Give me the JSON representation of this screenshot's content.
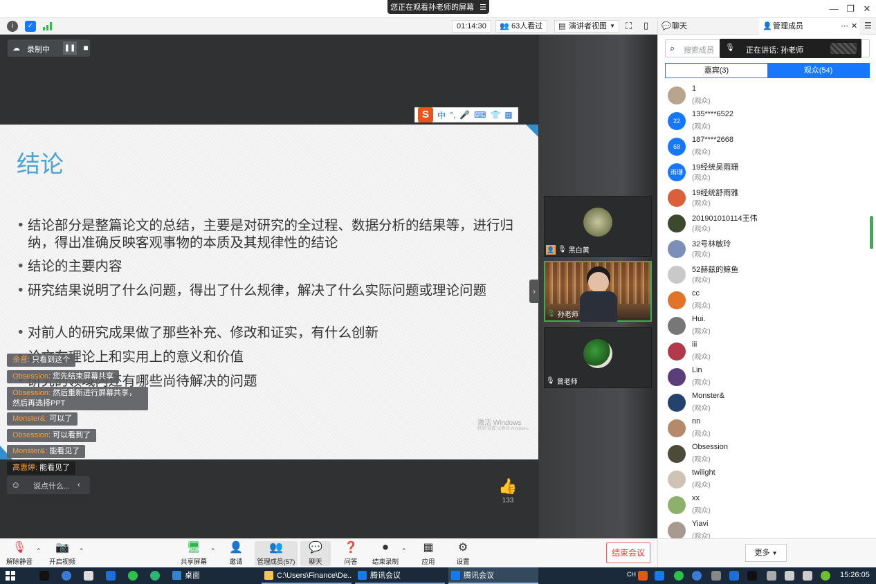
{
  "titlebar": {
    "share_notice": "您正在观看孙老师的屏幕",
    "menu_icon": "menu-icon"
  },
  "infobar": {
    "timer": "01:14:30",
    "viewers": "63人看过",
    "view_mode": "演讲者视图"
  },
  "recording": {
    "label": "录制中"
  },
  "ime": {
    "mode": "中"
  },
  "slide": {
    "title": "结论",
    "bullets": [
      "结论部分是整篇论文的总结，主要是对研究的全过程、数据分析的结果等，进行归纳，得出准确反映客观事物的本质及其规律性的结论",
      "结论的主要内容",
      "研究结果说明了什么问题，得出了什么规律，解决了什么实际问题或理论问题",
      "对前人的研究成果做了那些补充、修改和证实，有什么创新",
      "论文在理论上和实用上的意义和价值",
      "研究的领域内还有哪些尚待解决的问题"
    ],
    "watermark": "激活 Windows",
    "watermark_sub": "转到\"设置\"以激活 Windows。"
  },
  "chat": [
    {
      "name": "余音:",
      "text": "只看到这个"
    },
    {
      "name": "Obsession:",
      "text": "您先结束屏幕共享"
    },
    {
      "name": "Obsession:",
      "text": "然后重新进行屏幕共享，然后再选择PPT"
    },
    {
      "name": "Monster&:",
      "text": "可以了"
    },
    {
      "name": "Obsession:",
      "text": "可以看到了"
    },
    {
      "name": "Monster&:",
      "text": "能看见了"
    },
    {
      "name": "高惠婷:",
      "text": "能看见了"
    }
  ],
  "chat_input": {
    "placeholder": "说点什么..."
  },
  "likes": {
    "count": "133"
  },
  "tiles": [
    {
      "name": "黑白黄"
    },
    {
      "name": "孙老师"
    },
    {
      "name": "曾老师"
    }
  ],
  "rpanel": {
    "tab_chat": "聊天",
    "tab_members": "管理成员",
    "search_placeholder": "搜索成员",
    "speaking": "正在讲话: 孙老师",
    "seg_guests": "嘉宾(3)",
    "seg_audience": "观众(54)",
    "members": [
      {
        "name": "1",
        "role": "(观众)",
        "color": "#b9a58e",
        "avatar": ""
      },
      {
        "name": "135****6522",
        "role": "(观众)",
        "color": "#1677ff",
        "avatar": "22"
      },
      {
        "name": "187****2668",
        "role": "(观众)",
        "color": "#1677ff",
        "avatar": "68"
      },
      {
        "name": "19经统吴雨珊",
        "role": "(观众)",
        "color": "#1677ff",
        "avatar": "雨珊"
      },
      {
        "name": "19经统舒雨雅",
        "role": "(观众)",
        "color": "#d9603b",
        "avatar": ""
      },
      {
        "name": "201901010114王伟",
        "role": "(观众)",
        "color": "#3b4a2c",
        "avatar": ""
      },
      {
        "name": "32号林敏玲",
        "role": "(观众)",
        "color": "#7d8fb8",
        "avatar": ""
      },
      {
        "name": "52赫兹的鲸鱼",
        "role": "(观众)",
        "color": "#c9c9c9",
        "avatar": ""
      },
      {
        "name": "cc",
        "role": "(观众)",
        "color": "#e0742a",
        "avatar": ""
      },
      {
        "name": "Hui.",
        "role": "(观众)",
        "color": "#777777",
        "avatar": ""
      },
      {
        "name": "iii",
        "role": "(观众)",
        "color": "#b23a48",
        "avatar": ""
      },
      {
        "name": "Lin",
        "role": "(观众)",
        "color": "#5a3e7a",
        "avatar": ""
      },
      {
        "name": "Monster&",
        "role": "(观众)",
        "color": "#23426e",
        "avatar": ""
      },
      {
        "name": "nn",
        "role": "(观众)",
        "color": "#b48a6a",
        "avatar": ""
      },
      {
        "name": "Obsession",
        "role": "(观众)",
        "color": "#4e4a3a",
        "avatar": ""
      },
      {
        "name": "twilight",
        "role": "(观众)",
        "color": "#cfc3b5",
        "avatar": ""
      },
      {
        "name": "xx",
        "role": "(观众)",
        "color": "#8db06a",
        "avatar": ""
      },
      {
        "name": "Yiavi",
        "role": "(观众)",
        "color": "#a89a8e",
        "avatar": ""
      }
    ]
  },
  "bottombar": {
    "unmute": "解除静音",
    "video": "开启视频",
    "share": "共享屏幕",
    "invite": "邀请",
    "members": "管理成员(57)",
    "chat": "聊天",
    "qa": "问答",
    "end_rec": "结束录制",
    "apps": "应用",
    "settings": "设置",
    "end_meeting": "结束会议",
    "more": "更多"
  },
  "taskbar": {
    "desktop": "桌面",
    "explorer": "C:\\Users\\Finance\\De...",
    "tencent1": "腾讯会议",
    "tencent2": "腾讯会议",
    "lang": "CH",
    "time": "15:26:05"
  }
}
